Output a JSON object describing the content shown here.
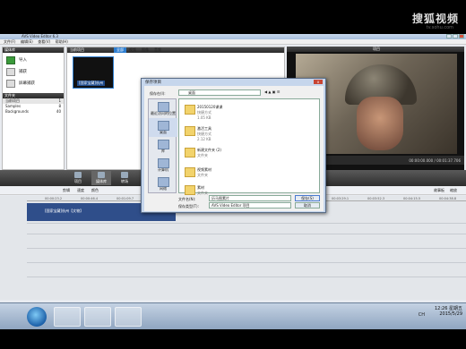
{
  "watermark": {
    "text": "搜狐视频",
    "url": "tv.sohu.com"
  },
  "window": {
    "title": "AVS Video Editor 6.3"
  },
  "menubar": [
    "文件(F)",
    "编辑(E)",
    "查看(V)",
    "帮助(H)"
  ],
  "left_panel": {
    "header": "媒体库",
    "buttons": [
      "导入",
      "捕获",
      "屏幕捕获"
    ],
    "folders_header": "文件夹",
    "folders": [
      {
        "name": "当前项目",
        "count": "1"
      },
      {
        "name": "Samples",
        "count": "8"
      },
      {
        "name": "Backgrounds",
        "count": "40"
      }
    ],
    "add_folder": "+添加文件夹",
    "delete_folder": "- 删除文件夹"
  },
  "media": {
    "header": "当前项目",
    "tabs": [
      "全部",
      "视频",
      "图像",
      "音频"
    ],
    "clip_caption": "[国家宝藏]杭州"
  },
  "preview": {
    "header": "项目",
    "time": "00:00:00.000 / 00:01:37.706"
  },
  "toolbar": {
    "items": [
      "项目",
      "媒体库",
      "转场",
      "视频特效",
      "文字"
    ]
  },
  "edit_tools": {
    "items": [
      "剪辑",
      "速度",
      "颜色"
    ],
    "right": [
      "故事板",
      "缩放"
    ]
  },
  "ruler": [
    "00:00:23.2",
    "00:00:46.4",
    "00:01:09.7",
    "00:01:32.9",
    "00:01:56.1",
    "00:02:19.4",
    "00:02:42.6",
    "00:03:05.8",
    "00:03:29.1",
    "00:03:52.3",
    "00:04:15.5",
    "00:04:38.8"
  ],
  "timeline_clip": "[国家宝藏]杭州【文物】",
  "dialog": {
    "title": "保存项目",
    "close": "x",
    "save_in_label": "保存在(I):",
    "save_in_value": "桌面",
    "places": [
      "最近访问的位置",
      "桌面",
      "库",
      "计算机",
      "网络"
    ],
    "files": [
      {
        "name": "20150120课课",
        "sub1": "快捷方式",
        "sub2": "1.05 KB"
      },
      {
        "name": "激活工具",
        "sub1": "快捷方式",
        "sub2": "2.12 KB"
      },
      {
        "name": "新建文件夹 (2)",
        "sub1": "文件夹",
        "sub2": ""
      },
      {
        "name": "视频素材",
        "sub1": "文件夹",
        "sub2": ""
      },
      {
        "name": "素材",
        "sub1": "文件夹",
        "sub2": ""
      }
    ],
    "filename_label": "文件名(N):",
    "filename_value": "历马图素片",
    "filetype_label": "保存类型(T):",
    "filetype_value": "AVS Video Editor 项目",
    "save_button": "保存(S)",
    "cancel_button": "取消"
  },
  "taskbar": {
    "language": "CH",
    "time": "12:26 星期五",
    "date": "2015/5/29"
  }
}
